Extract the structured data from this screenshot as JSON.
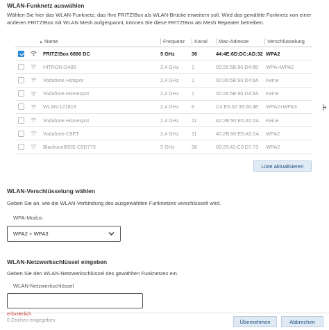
{
  "wlan_select": {
    "title": "WLAN-Funknetz auswählen",
    "description": "Wählen Sie hier das WLAN-Funknetz, das Ihre FRITZ!Box als WLAN-Brücke erweitern soll. Wird das gewählte Funknetz von einer anderen FRITZ!Box mit WLAN Mesh aufgespannt, können Sie diese FRITZ!Box als Mesh Repeater betreiben.",
    "columns": {
      "name": "Name",
      "freq": "Frequenz",
      "channel": "Kanal",
      "mac": "Mac-Adresse",
      "enc": "Verschlüsselung"
    },
    "networks": [
      {
        "name": "FRITZ!Box 6890 DC",
        "freq": "5 GHz",
        "channel": "36",
        "mac": "44:4E:6D:DC:AD:32",
        "enc": "WPA2",
        "selected": true
      },
      {
        "name": "HITRON-D480",
        "freq": "2,4 GHz",
        "channel": "1",
        "mac": "00:26:5B:96:D4:88",
        "enc": "WPA+WPA2",
        "selected": false
      },
      {
        "name": "Vodafone Hotspot",
        "freq": "2,4 GHz",
        "channel": "1",
        "mac": "00:26:5B:96:D4:8A",
        "enc": "Keine",
        "selected": false
      },
      {
        "name": "Vodafone Homespot",
        "freq": "2,4 GHz",
        "channel": "1",
        "mac": "00:26:5B:96:D4:8A",
        "enc": "Keine",
        "selected": false
      },
      {
        "name": "WLAN-121819",
        "freq": "2,4 GHz",
        "channel": "6",
        "mac": "C4:E5:32:39:06:4E",
        "enc": "WPA2+WPA3",
        "selected": false
      },
      {
        "name": "Vodafone Homespot",
        "freq": "2,4 GHz",
        "channel": "11",
        "mac": "42:2B:50:E5:A5:2A",
        "enc": "Keine",
        "selected": false
      },
      {
        "name": "Vodafone-C8ET",
        "freq": "2,4 GHz",
        "channel": "11",
        "mac": "40:2B:50:E5:A5:2A",
        "enc": "WPA2",
        "selected": false
      },
      {
        "name": "Blackvue900S-C0D773",
        "freq": "5 GHz",
        "channel": "36",
        "mac": "00:25:42:C0:D7:73",
        "enc": "WPA2",
        "selected": false
      }
    ],
    "refresh_label": "Liste aktualisieren"
  },
  "encryption": {
    "title": "WLAN-Verschlüsselung wählen",
    "description": "Geben Sie an, wie die WLAN-Verbindung des ausgewählten Funknetzes verschlüsselt wird.",
    "mode_label": "WPA-Modus",
    "mode_value": "WPA2 + WPA3"
  },
  "key": {
    "title": "WLAN-Netzwerkschlüssel eingeben",
    "description": "Geben Sie den WLAN-Netzwerkschlüssel des gewählten Funknetzes ein.",
    "field_label": "WLAN-Netzwerkschlüssel",
    "value": "",
    "hint_required": "erforderlich",
    "hint_count": "0 Zeichen eingegeben"
  },
  "footer": {
    "apply_label": "Übernehmen",
    "cancel_label": "Abbrechen"
  },
  "colors": {
    "accent": "#2b8ad6",
    "button_bg": "#dfeaf5"
  }
}
